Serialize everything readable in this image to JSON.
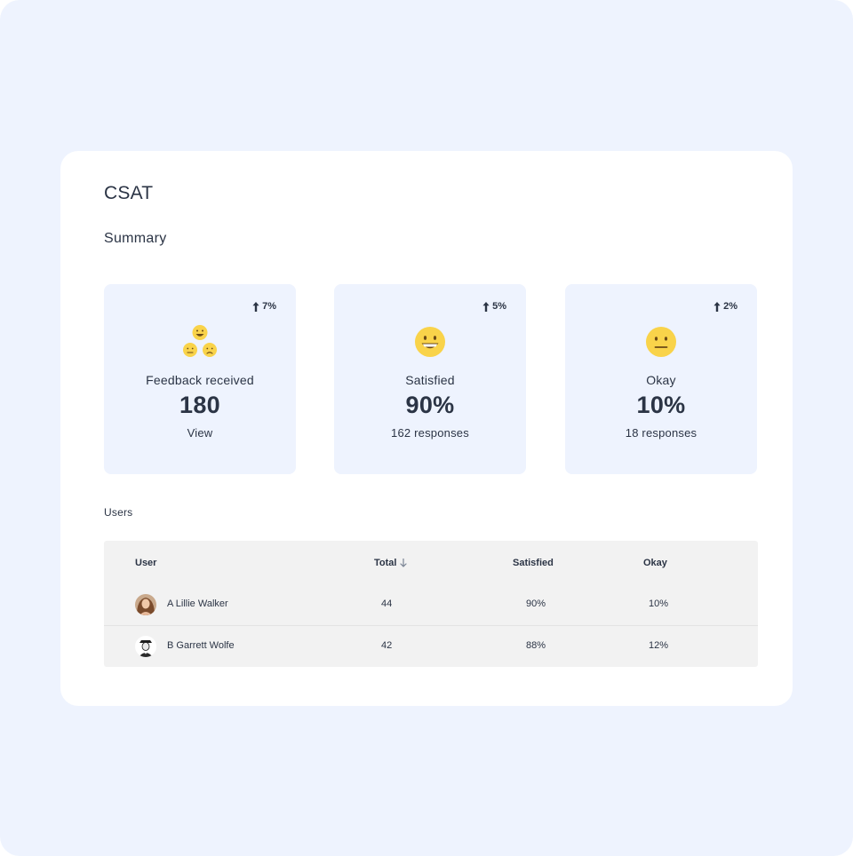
{
  "page": {
    "title": "CSAT",
    "summary_label": "Summary",
    "users_label": "Users"
  },
  "colors": {
    "background": "#eef3fe",
    "panel": "#ffffff",
    "card": "#eef3fe",
    "table": "#f2f2f2",
    "text": "#2b3445",
    "emoji": "#f9d34a"
  },
  "cards": [
    {
      "trend": "7%",
      "trend_icon": "arrow-up-icon",
      "icon": "emoji-group-icon",
      "label": "Feedback received",
      "value": "180",
      "sub": "View"
    },
    {
      "trend": "5%",
      "trend_icon": "arrow-up-icon",
      "icon": "grinning-face-icon",
      "label": "Satisfied",
      "value": "90%",
      "sub": "162 responses"
    },
    {
      "trend": "2%",
      "trend_icon": "arrow-up-icon",
      "icon": "neutral-face-icon",
      "label": "Okay",
      "value": "10%",
      "sub": "18 responses"
    }
  ],
  "table": {
    "columns": [
      "User",
      "Total",
      "Satisfied",
      "Okay"
    ],
    "sort_icon": "arrow-down-icon",
    "rows": [
      {
        "user": "A Lillie Walker",
        "total": "44",
        "satisfied": "90%",
        "okay": "10%"
      },
      {
        "user": "B Garrett Wolfe",
        "total": "42",
        "satisfied": "88%",
        "okay": "12%"
      }
    ]
  }
}
